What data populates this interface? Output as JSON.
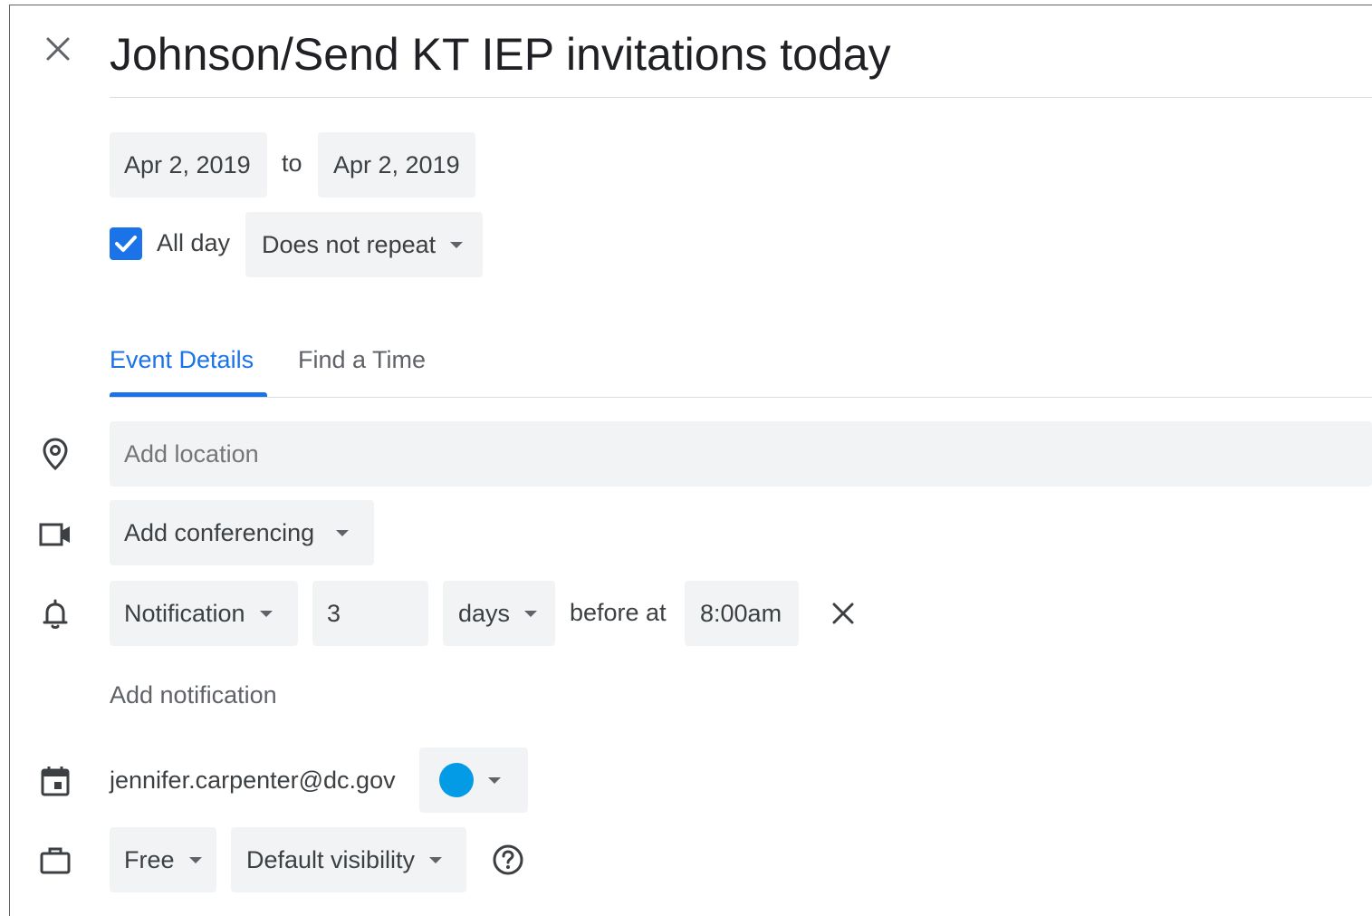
{
  "event": {
    "title": "Johnson/Send KT IEP invitations today"
  },
  "dates": {
    "start": "Apr 2, 2019",
    "separator": "to",
    "end": "Apr 2, 2019"
  },
  "all_day": {
    "checked": true,
    "label": "All day"
  },
  "repeat": {
    "selected": "Does not repeat"
  },
  "tabs": [
    {
      "label": "Event Details",
      "active": true
    },
    {
      "label": "Find a Time",
      "active": false
    }
  ],
  "location": {
    "placeholder": "Add location"
  },
  "conferencing": {
    "label": "Add conferencing"
  },
  "notification": {
    "type": "Notification",
    "amount": "3",
    "unit": "days",
    "before_at": "before at",
    "time": "8:00am"
  },
  "add_notification": "Add notification",
  "calendar": {
    "owner": "jennifer.carpenter@dc.gov",
    "color": "#039be5"
  },
  "availability": {
    "selected": "Free"
  },
  "visibility": {
    "selected": "Default visibility"
  },
  "colors": {
    "accent": "#1a73e8",
    "chip_bg": "#f1f3f4",
    "icon": "#5f6368"
  }
}
